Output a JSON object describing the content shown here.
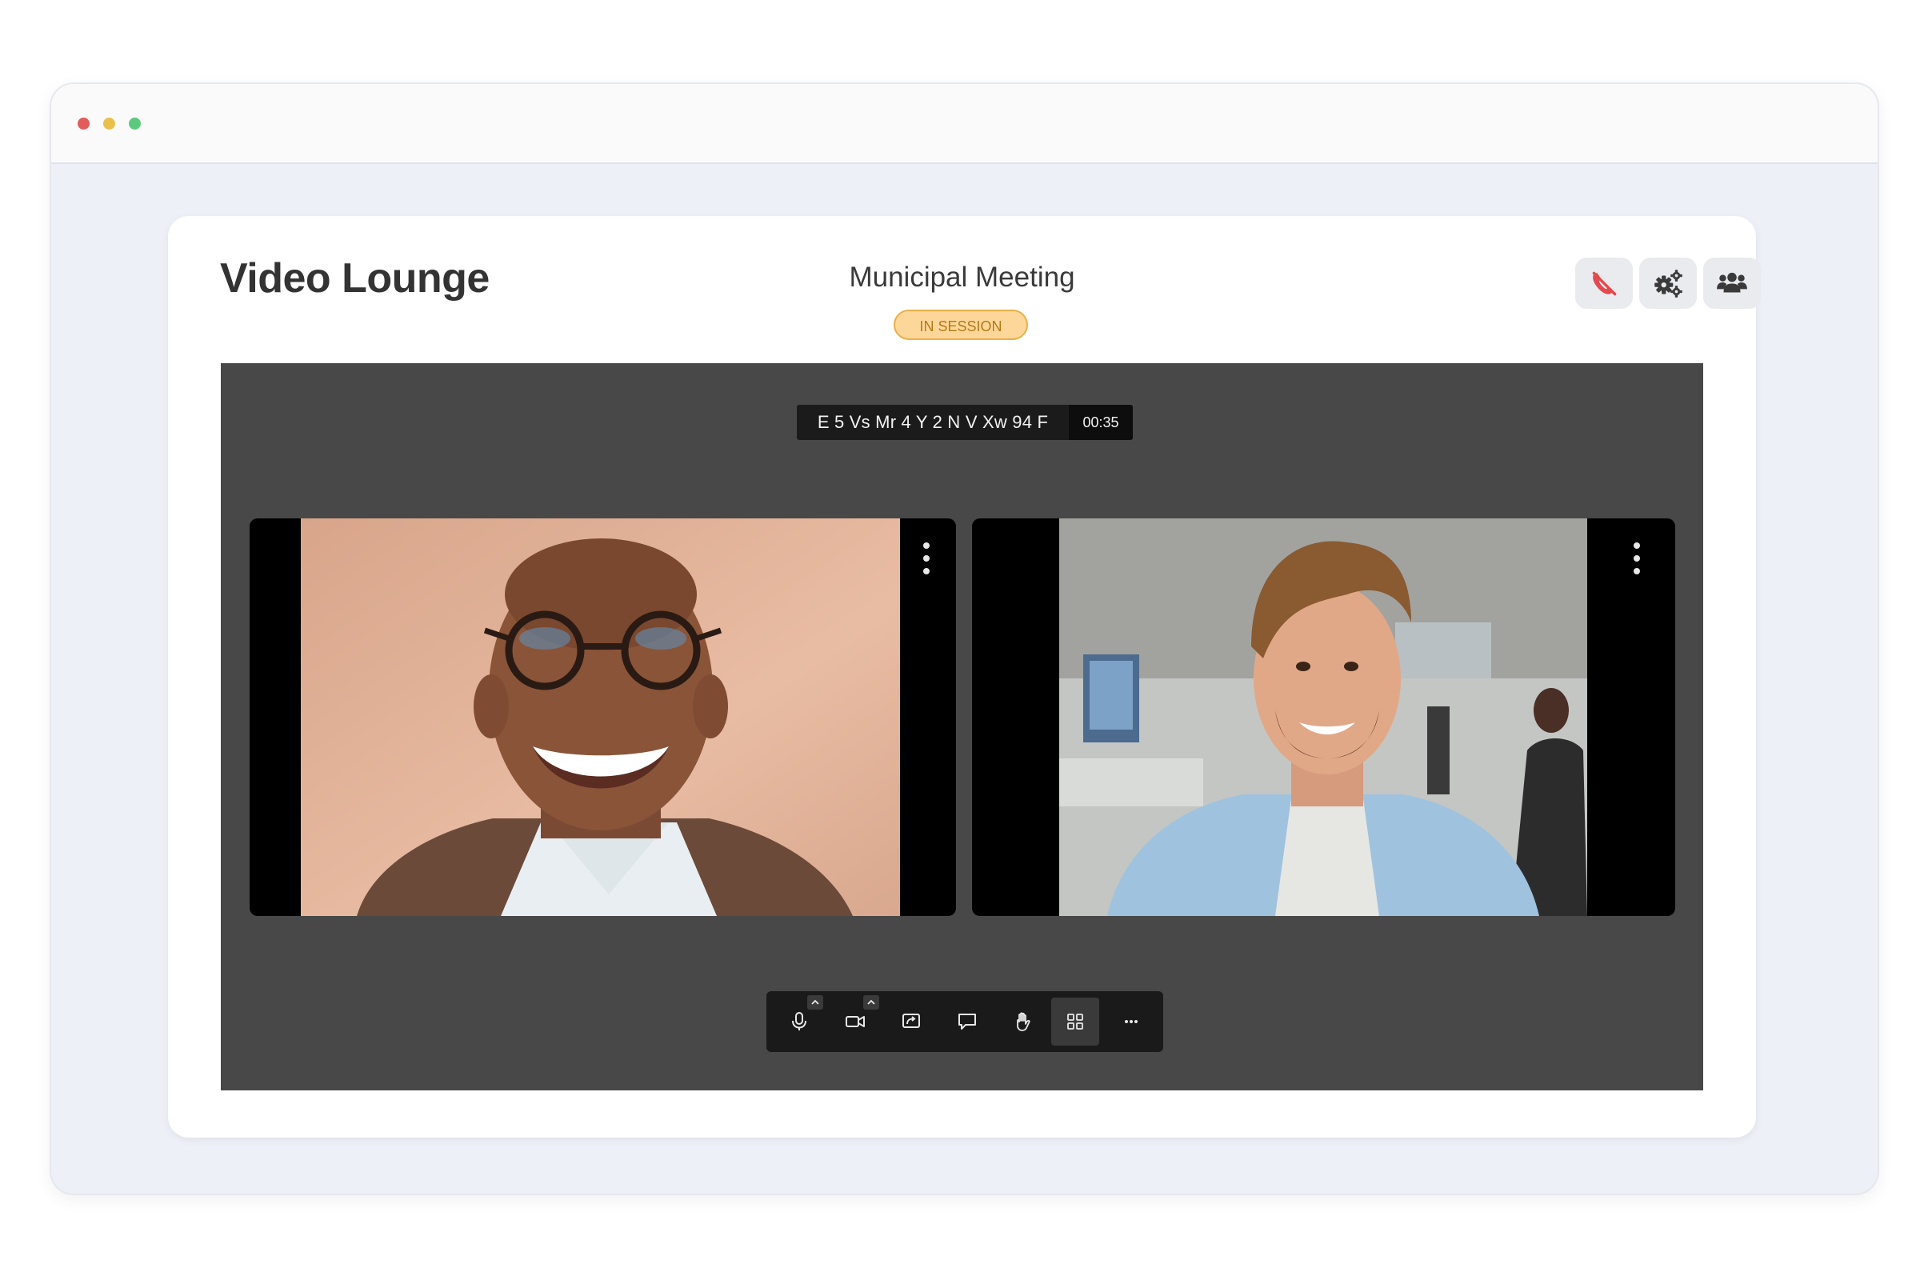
{
  "colors": {
    "window_dot_red": "#e25c5c",
    "window_dot_yellow": "#e9c04c",
    "window_dot_green": "#5cc97e",
    "accent_badge": "#fdd79a",
    "hangup_red": "#e5484d",
    "stage_bg": "#484848"
  },
  "app": {
    "title": "Video Lounge"
  },
  "meeting": {
    "name": "Municipal Meeting",
    "status": "IN SESSION"
  },
  "header_actions": [
    {
      "icon": "phone-hangup-icon"
    },
    {
      "icon": "gears-icon"
    },
    {
      "icon": "users-icon"
    }
  ],
  "stage": {
    "room_id": "E 5 Vs Mr 4 Y 2 N V Xw 94 F",
    "timer": "00:35"
  },
  "participants": [
    {
      "icon": "more-vertical-icon"
    },
    {
      "icon": "more-vertical-icon"
    }
  ],
  "toolbar": [
    {
      "icon": "microphone-icon",
      "has_menu": true
    },
    {
      "icon": "camera-icon",
      "has_menu": true
    },
    {
      "icon": "screen-share-icon"
    },
    {
      "icon": "chat-icon"
    },
    {
      "icon": "raise-hand-icon"
    },
    {
      "icon": "grid-view-icon",
      "active": true
    },
    {
      "icon": "more-horizontal-icon"
    }
  ]
}
